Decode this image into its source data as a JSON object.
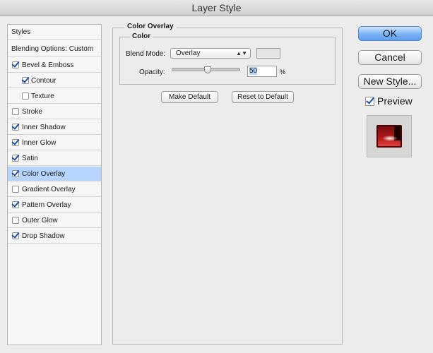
{
  "window": {
    "title": "Layer Style"
  },
  "sidebar": {
    "header_styles": "Styles",
    "header_blending": "Blending Options: Custom",
    "items": [
      {
        "label": "Bevel & Emboss",
        "checked": true
      },
      {
        "label": "Contour",
        "checked": true
      },
      {
        "label": "Texture",
        "checked": false
      },
      {
        "label": "Stroke",
        "checked": false
      },
      {
        "label": "Inner Shadow",
        "checked": true
      },
      {
        "label": "Inner Glow",
        "checked": true
      },
      {
        "label": "Satin",
        "checked": true
      },
      {
        "label": "Color Overlay",
        "checked": true,
        "selected": true
      },
      {
        "label": "Gradient Overlay",
        "checked": false
      },
      {
        "label": "Pattern Overlay",
        "checked": true
      },
      {
        "label": "Outer Glow",
        "checked": false
      },
      {
        "label": "Drop Shadow",
        "checked": true
      }
    ]
  },
  "panel": {
    "title": "Color Overlay",
    "group_title": "Color",
    "blend_mode_label": "Blend Mode:",
    "blend_mode_value": "Overlay",
    "opacity_label": "Opacity:",
    "opacity_value": "50",
    "opacity_unit": "%",
    "opacity_level": 0.5,
    "make_default_label": "Make Default",
    "reset_default_label": "Reset to Default"
  },
  "actions": {
    "ok_label": "OK",
    "cancel_label": "Cancel",
    "new_style_label": "New Style...",
    "preview_label": "Preview",
    "preview_checked": true
  },
  "colors": {
    "selected_row": "#b5d5ff",
    "ok_button": "#79b2f4",
    "checkmark": "#1b4fa6"
  }
}
